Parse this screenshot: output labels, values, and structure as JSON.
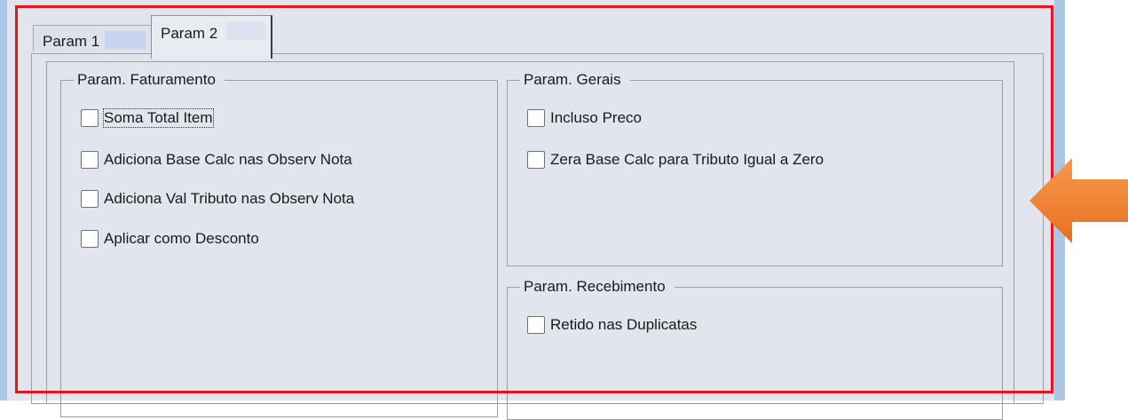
{
  "tabs": [
    {
      "label": "Param 1",
      "selected": false
    },
    {
      "label": "Param 2",
      "selected": true
    }
  ],
  "groups": {
    "faturamento": {
      "title": "Param. Faturamento",
      "items": [
        {
          "label": "Soma Total Item",
          "checked": false,
          "focused": true
        },
        {
          "label": "Adiciona Base Calc nas Observ Nota",
          "checked": false
        },
        {
          "label": "Adiciona Val Tributo nas Observ Nota",
          "checked": false
        },
        {
          "label": "Aplicar como Desconto",
          "checked": false
        }
      ]
    },
    "gerais": {
      "title": "Param. Gerais",
      "items": [
        {
          "label": "Incluso Preco",
          "checked": false
        },
        {
          "label": "Zera Base Calc para Tributo Igual a Zero",
          "checked": false
        }
      ]
    },
    "recebimento": {
      "title": "Param. Recebimento",
      "items": [
        {
          "label": "Retido nas Duplicatas",
          "checked": false
        }
      ]
    }
  },
  "colors": {
    "highlight_border": "#e8141b",
    "annotation_arrow": "#ed7d31",
    "panel_background": "#e3e5ee"
  },
  "icons": {
    "annotation": "left-arrow-icon"
  }
}
